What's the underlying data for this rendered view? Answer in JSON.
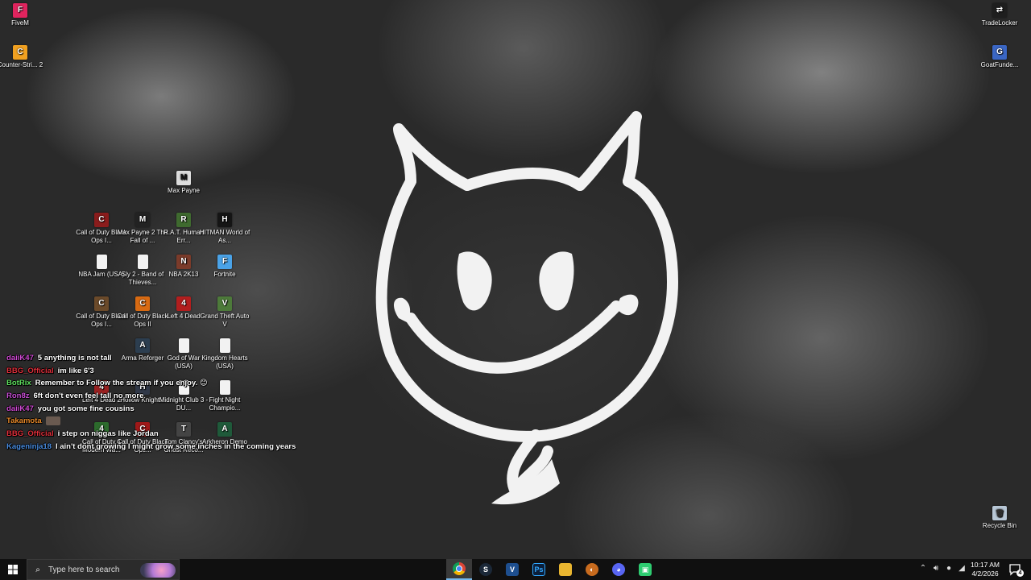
{
  "desktop_icons": [
    {
      "label": "FiveM",
      "icon": "fivem-icon",
      "color": "#e0245e",
      "glyph": "F"
    },
    {
      "label": "Counter-Stri... 2",
      "icon": "counter-strike-2-icon",
      "color": "#f0a020",
      "glyph": "C"
    },
    {
      "label": "TradeLocker",
      "icon": "tradelocker-icon",
      "color": "#1e1e1e",
      "glyph": "⇄"
    },
    {
      "label": "GoatFunde...",
      "icon": "goatfunded-icon",
      "color": "#3a66c4",
      "glyph": "G"
    },
    {
      "label": "Max Payne",
      "icon": "max-payne-icon",
      "color": "#dddddd",
      "glyph": "M"
    },
    {
      "label": "Call of Duty Black Ops I...",
      "icon": "call-of-duty-icon",
      "color": "#8a1c1c",
      "glyph": "C"
    },
    {
      "label": "Max Payne 2 The Fall of ...",
      "icon": "max-payne-2-icon",
      "color": "#222222",
      "glyph": "M"
    },
    {
      "label": "R.A.T. Human Err...",
      "icon": "rat-icon",
      "color": "#3f6a2f",
      "glyph": "R"
    },
    {
      "label": "HITMAN World of As...",
      "icon": "hitman-icon",
      "color": "#151515",
      "glyph": "H"
    },
    {
      "label": "NBA Jam (USA)",
      "icon": "file-icon",
      "color": "#f2f2f2",
      "glyph": ""
    },
    {
      "label": "Sly 2 - Band of Thieves...",
      "icon": "file-icon",
      "color": "#f2f2f2",
      "glyph": ""
    },
    {
      "label": "NBA 2K13",
      "icon": "nba-2k13-icon",
      "color": "#7b3b2a",
      "glyph": "N"
    },
    {
      "label": "Fortnite",
      "icon": "fortnite-icon",
      "color": "#4aa3e8",
      "glyph": "F"
    },
    {
      "label": "Call of Duty Black Ops I...",
      "icon": "call-of-duty-icon",
      "color": "#6b4a2a",
      "glyph": "C"
    },
    {
      "label": "Call of Duty Black Ops II",
      "icon": "call-of-duty-bo2-icon",
      "color": "#d86a12",
      "glyph": "C"
    },
    {
      "label": "Left 4 Dead",
      "icon": "left-4-dead-icon",
      "color": "#b21e1e",
      "glyph": "4"
    },
    {
      "label": "Grand Theft Auto V",
      "icon": "gta-v-icon",
      "color": "#4d7a3a",
      "glyph": "V"
    },
    {
      "label": "Arma Reforger",
      "icon": "arma-reforger-icon",
      "color": "#2c3e50",
      "glyph": "A"
    },
    {
      "label": "God of War (USA)",
      "icon": "file-icon",
      "color": "#f2f2f2",
      "glyph": ""
    },
    {
      "label": "Kingdom Hearts (USA)",
      "icon": "file-icon",
      "color": "#f2f2f2",
      "glyph": ""
    },
    {
      "label": "Left 4 Dead 2",
      "icon": "left-4-dead-2-icon",
      "color": "#9a2020",
      "glyph": "4"
    },
    {
      "label": "Hollow Knight...",
      "icon": "hollow-knight-icon",
      "color": "#303848",
      "glyph": "H"
    },
    {
      "label": "Midnight Club 3 - DU...",
      "icon": "file-icon",
      "color": "#f2f2f2",
      "glyph": ""
    },
    {
      "label": "Fight Night Champio...",
      "icon": "file-icon",
      "color": "#f2f2f2",
      "glyph": ""
    },
    {
      "label": "Call of Duty 4 Modern Wa...",
      "icon": "call-of-duty-4-icon",
      "color": "#2c6b2c",
      "glyph": "4"
    },
    {
      "label": "Call of Duty Black Ops...",
      "icon": "call-of-duty-icon",
      "color": "#a01818",
      "glyph": "C"
    },
    {
      "label": "Tom Clancy's Ghost Reco...",
      "icon": "ghost-recon-icon",
      "color": "#444444",
      "glyph": "T"
    },
    {
      "label": "Arkheron Demo",
      "icon": "arkheron-icon",
      "color": "#1f5a3a",
      "glyph": "A"
    },
    {
      "label": "Recycle Bin",
      "icon": "recycle-bin-icon",
      "color": "#b8c7d6",
      "glyph": "🗑"
    }
  ],
  "chat": [
    {
      "user": "daiiK47",
      "color": "#d24cd6",
      "message": "5 anything is not tall"
    },
    {
      "user": "BBG_Official",
      "color": "#e0303c",
      "message": "im like 6'3"
    },
    {
      "user": "BotRix",
      "color": "#5fe05f",
      "message": "Remember to Follow the stream if you enjoy. 😊"
    },
    {
      "user": "Ron8z",
      "color": "#c84fd6",
      "message": "6ft don't even feel tall no more"
    },
    {
      "user": "daiiK47",
      "color": "#d24cd6",
      "message": "you got some fine cousins"
    },
    {
      "user": "Takamota",
      "color": "#e88a2a",
      "message": ""
    },
    {
      "user": "BBG_Official",
      "color": "#e0303c",
      "message": "i step on niggas like Jordan"
    },
    {
      "user": "Kageninja18",
      "color": "#4a8de0",
      "message": "I ain't dont growing I might grow some inches in the coming years"
    }
  ],
  "taskbar": {
    "search_placeholder": "Type here to search",
    "apps": [
      {
        "name": "chrome-icon",
        "glyph": "◉",
        "color": "#db4437",
        "active": true
      },
      {
        "name": "steam-icon",
        "glyph": "S",
        "color": "#1b2838",
        "active": false
      },
      {
        "name": "visual-studio-icon",
        "glyph": "V",
        "color": "#1e4f8f",
        "active": false
      },
      {
        "name": "photoshop-icon",
        "glyph": "Ps",
        "color": "#0b1f3a",
        "active": false
      },
      {
        "name": "file-explorer-icon",
        "glyph": "▆",
        "color": "#e8b530",
        "active": false
      },
      {
        "name": "app-icon",
        "glyph": "◐",
        "color": "#c86b1e",
        "active": false
      },
      {
        "name": "discord-icon",
        "glyph": "◕",
        "color": "#5865f2",
        "active": false
      },
      {
        "name": "app-green-icon",
        "glyph": "▣",
        "color": "#2ecc71",
        "active": false
      }
    ],
    "clock_time": "10:17 AM",
    "clock_date": "4/2/2026",
    "notification_count": "4"
  }
}
